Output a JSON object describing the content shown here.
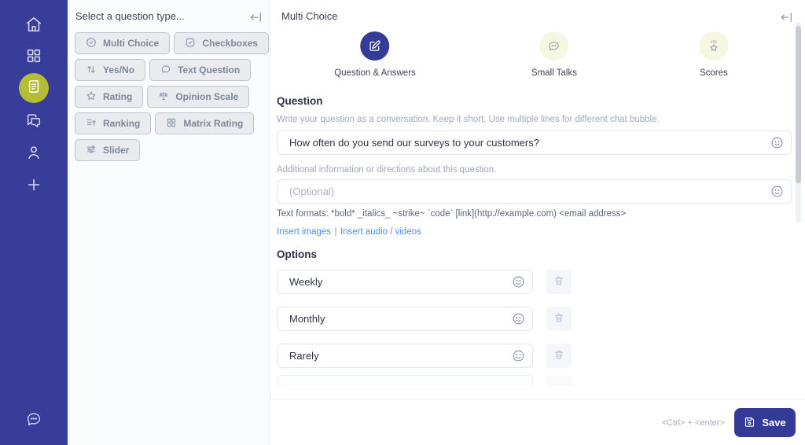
{
  "colors": {
    "sidebar": "#383d99",
    "accent": "#343b96",
    "active_icon_circle": "#b5be33",
    "inactive_step_circle": "#f5f7e1",
    "link": "#4a90f4"
  },
  "sidebar": {
    "items": [
      {
        "name": "home",
        "icon": "home-icon"
      },
      {
        "name": "dashboard",
        "icon": "grid-icon"
      },
      {
        "name": "surveys",
        "icon": "document-icon",
        "active": true
      },
      {
        "name": "conversations",
        "icon": "chat-duo-icon"
      },
      {
        "name": "contacts",
        "icon": "person-icon"
      },
      {
        "name": "add-new",
        "icon": "plus-icon"
      }
    ],
    "bottom_item": {
      "name": "support-chat",
      "icon": "chat-dots-icon"
    }
  },
  "type_panel": {
    "title": "Select a question type...",
    "types": [
      {
        "label": "Multi Choice",
        "icon": "radio-check"
      },
      {
        "label": "Checkboxes",
        "icon": "checkbox"
      },
      {
        "label": "Yes/No",
        "icon": "up-down-arrows"
      },
      {
        "label": "Text Question",
        "icon": "chat-bubble"
      },
      {
        "label": "Rating",
        "icon": "star"
      },
      {
        "label": "Opinion Scale",
        "icon": "scale"
      },
      {
        "label": "Ranking",
        "icon": "ranking-list"
      },
      {
        "label": "Matrix Rating",
        "icon": "grid"
      },
      {
        "label": "Slider",
        "icon": "slider"
      }
    ]
  },
  "editor": {
    "title": "Multi Choice",
    "steps": [
      {
        "label": "Question & Answers",
        "active": true,
        "icon": "edit"
      },
      {
        "label": "Small Talks",
        "active": false,
        "icon": "chat-dots"
      },
      {
        "label": "Scores",
        "active": false,
        "icon": "score-star"
      }
    ],
    "question": {
      "heading": "Question",
      "helper": "Write your question as a conversation. Keep it short. Use multiple lines for different chat bubble.",
      "value": "How often do you send our surveys to your customers?",
      "additional_helper": "Additional information or directions about this question.",
      "optional_placeholder": "(Optional)",
      "formats_hint": "Text formats: *bold* _italics_ ~strike~ `code` [link](http://example.com) <email address>",
      "insert_images_link": "Insert images",
      "links_separator": "|",
      "insert_media_link": "Insert audio / videos"
    },
    "options": {
      "heading": "Options",
      "items": [
        {
          "value": "Weekly"
        },
        {
          "value": "Monthly"
        },
        {
          "value": "Rarely"
        }
      ]
    },
    "footer": {
      "shortcut_hint": "<Ctrl> + <enter>",
      "save_label": "Save"
    }
  }
}
